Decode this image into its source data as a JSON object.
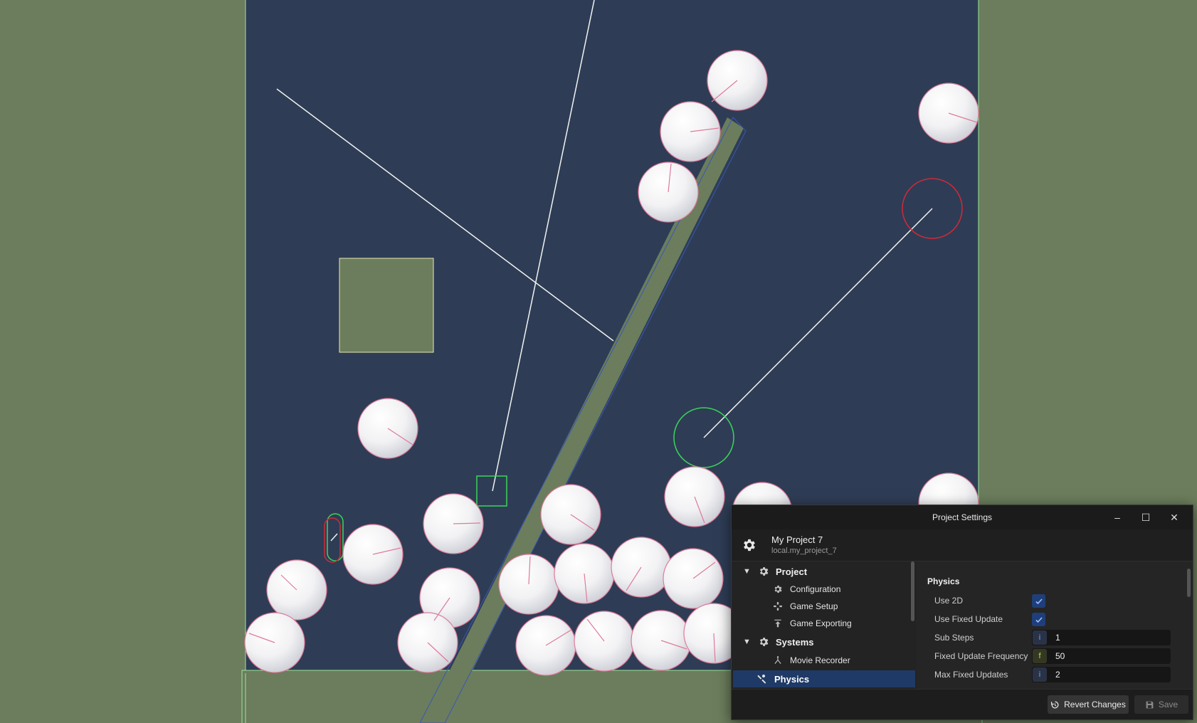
{
  "window": {
    "title": "Project Settings",
    "buttons": {
      "minimize": "–",
      "maximize": "☐",
      "close": "✕"
    }
  },
  "project": {
    "name": "My Project 7",
    "id": "local.my_project_7"
  },
  "tree": {
    "project_label": "Project",
    "configuration": "Configuration",
    "game_setup": "Game Setup",
    "game_exporting": "Game Exporting",
    "systems_label": "Systems",
    "movie_recorder": "Movie Recorder",
    "physics": "Physics"
  },
  "properties": {
    "section": "Physics",
    "use_2d": {
      "label": "Use 2D",
      "checked": true
    },
    "use_fixed_update": {
      "label": "Use Fixed Update",
      "checked": true
    },
    "sub_steps": {
      "label": "Sub Steps",
      "type": "i",
      "value": "1"
    },
    "fixed_update_frequency": {
      "label": "Fixed Update Frequency",
      "type": "f",
      "value": "50"
    },
    "max_fixed_updates": {
      "label": "Max Fixed Updates",
      "type": "i",
      "value": "2"
    }
  },
  "footer": {
    "revert": "Revert Changes",
    "save": "Save"
  },
  "colors": {
    "scene_background": "#6b7d5c",
    "playfield": "#2e3d55",
    "accent_selected": "#1f3a66",
    "ball_outline": "#e07a9a",
    "gizmo_green": "#3bd45a",
    "gizmo_red": "#d3283a"
  }
}
